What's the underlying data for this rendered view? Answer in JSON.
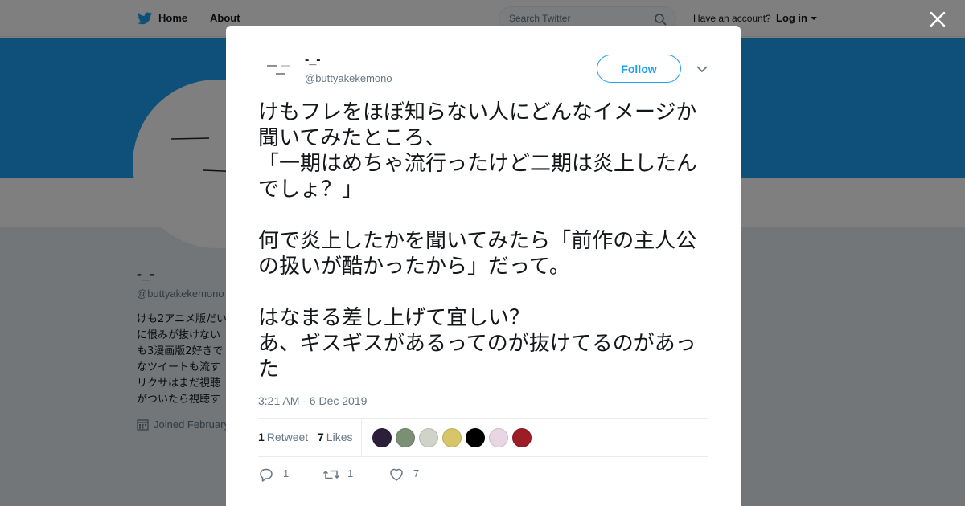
{
  "nav": {
    "home": "Home",
    "about": "About",
    "search_placeholder": "Search Twitter",
    "have_account": "Have an account?",
    "login": "Log in"
  },
  "profile": {
    "name": "-_-",
    "handle": "@buttyakekemono",
    "bio_lines": [
      "けも2アニメ版だい",
      "に恨みが抜けない",
      "も3漫画版2好きで",
      "なツイートも流す",
      "リクサはまだ視聴",
      "がついたら視聴す"
    ],
    "joined": "Joined February"
  },
  "tweet": {
    "author_name": "-_-",
    "author_handle": "@buttyakekemono",
    "follow_label": "Follow",
    "text": "けもフレをほぼ知らない人にどんなイメージか聞いてみたところ、\n「一期はめちゃ流行ったけど二期は炎上したんでしょ？」\n\n何で炎上したかを聞いてみたら「前作の主人公の扱いが酷かったから」だって。\n\nはなまる差し上げて宜しい？\nあ、ギスギスがあるってのが抜けてるのがあった",
    "timestamp": "3:21 AM - 6 Dec 2019",
    "retweet_count": "1",
    "retweet_label": "Retweet",
    "like_count": "7",
    "like_label": "Likes",
    "reply_action_count": "1",
    "retweet_action_count": "1",
    "like_action_count": "7"
  },
  "likers": [
    {
      "name": "liker-avatar-1",
      "color": "#2b1f3a"
    },
    {
      "name": "liker-avatar-2",
      "color": "#7a8f74"
    },
    {
      "name": "liker-avatar-3",
      "color": "#cfd3c8"
    },
    {
      "name": "liker-avatar-4",
      "color": "#d7c56a"
    },
    {
      "name": "liker-avatar-5",
      "color": "#000000"
    },
    {
      "name": "liker-avatar-6",
      "color": "#e8d7e3"
    },
    {
      "name": "liker-avatar-7",
      "color": "#9b1d25"
    }
  ],
  "colors": {
    "brand": "#1da1f2",
    "text": "#14171a",
    "muted": "#657786",
    "border": "#e6ecf0"
  }
}
